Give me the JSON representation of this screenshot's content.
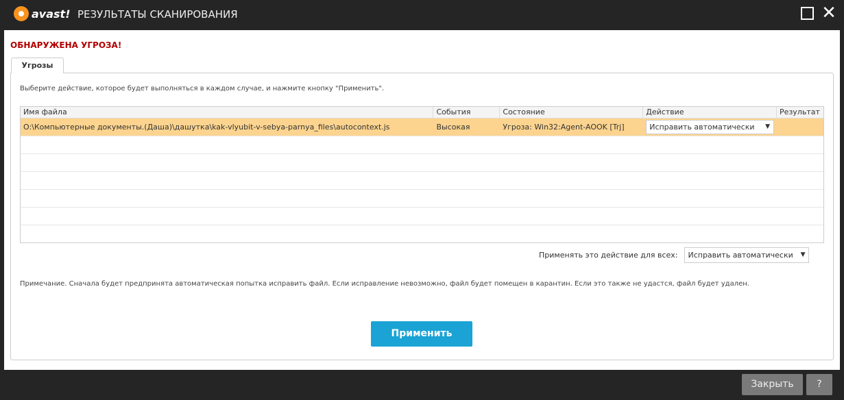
{
  "window": {
    "logo": "avast!",
    "title": "РЕЗУЛЬТАТЫ СКАНИРОВАНИЯ"
  },
  "alert": "ОБНАРУЖЕНА УГРОЗА!",
  "tab": "Угрозы",
  "instruction": "Выберите действие, которое будет выполняться в каждом случае, и нажмите кнопку \"Применить\".",
  "table": {
    "headers": [
      "Имя файла",
      "События",
      "Состояние",
      "Действие",
      "Результат"
    ],
    "rows": [
      {
        "file": "O:\\Компьютерные документы.(Даша)\\дашутка\\kak-vlyubit-v-sebya-parnya_files\\autocontext.js",
        "event": "Высокая",
        "state": "Угроза: Win32:Agent-AOOK [Trj]",
        "action": "Исправить автоматически",
        "result": ""
      }
    ]
  },
  "apply_all": {
    "label": "Применять это действие для всех:",
    "value": "Исправить автоматически"
  },
  "note": "Примечание. Сначала будет предпринята автоматическая попытка исправить файл. Если исправление невозможно, файл будет помещен в карантин. Если это также не удастся, файл будет удален.",
  "buttons": {
    "apply": "Применить",
    "close": "Закрыть",
    "help": "?"
  },
  "colors": {
    "accent": "#1aa3d4",
    "alert": "#b20000",
    "selected_row": "#fcd48f"
  }
}
